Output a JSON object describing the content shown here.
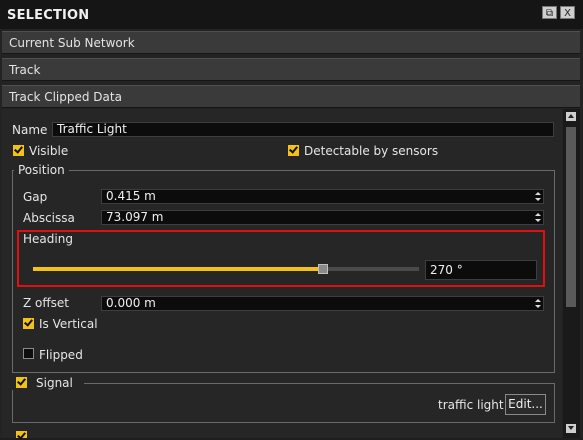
{
  "window": {
    "title": "SELECTION",
    "restore_glyph": "⧉",
    "close_glyph": "X"
  },
  "sections": {
    "current_sub_network": "Current Sub Network",
    "track": "Track",
    "track_clipped_data": "Track Clipped Data"
  },
  "properties": {
    "name_label": "Name",
    "name_value": "Traffic Light",
    "visible_label": "Visible",
    "visible_checked": true,
    "detectable_label": "Detectable by sensors",
    "detectable_checked": true
  },
  "position": {
    "legend": "Position",
    "gap_label": "Gap",
    "gap_value": "0.415 m",
    "abscissa_label": "Abscissa",
    "abscissa_value": "73.097 m",
    "heading_label": "Heading",
    "heading_value": "270 °",
    "heading_slider_fraction": 0.75,
    "z_offset_label": "Z offset",
    "z_offset_value": "0.000 m",
    "is_vertical_label": "Is Vertical",
    "is_vertical_checked": true,
    "flipped_label": "Flipped",
    "flipped_checked": false
  },
  "signal": {
    "legend": "Signal",
    "checked": true,
    "type_label": "traffic light",
    "edit_label": "Edit..."
  },
  "colors": {
    "accent": "#f2c21a",
    "highlight": "#e01010",
    "slider_rest": "#4a4a4a"
  }
}
